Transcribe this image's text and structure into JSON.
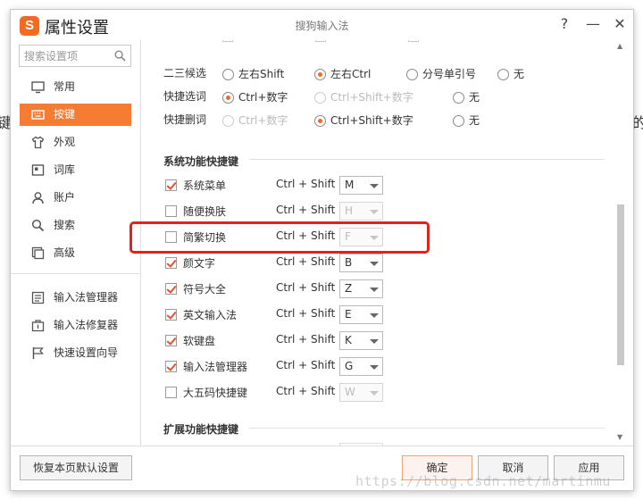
{
  "background": {
    "left_char": "键",
    "right_char": "的"
  },
  "window": {
    "title": "属性设置",
    "app_name": "搜狗输入法",
    "logo_char": "S",
    "help_label": "?",
    "minimize_label": "—",
    "close_label": "✕"
  },
  "sidebar": {
    "search_placeholder": "搜索设置项",
    "items": [
      {
        "label": "常用",
        "icon": "monitor-icon"
      },
      {
        "label": "按键",
        "icon": "keyboard-icon",
        "active": true
      },
      {
        "label": "外观",
        "icon": "shirt-icon"
      },
      {
        "label": "词库",
        "icon": "book-icon"
      },
      {
        "label": "账户",
        "icon": "user-icon"
      },
      {
        "label": "搜索",
        "icon": "search-icon"
      },
      {
        "label": "高级",
        "icon": "advanced-icon"
      }
    ],
    "tools": [
      {
        "label": "输入法管理器",
        "icon": "manager-icon"
      },
      {
        "label": "输入法修复器",
        "icon": "repair-icon"
      },
      {
        "label": "快速设置向导",
        "icon": "flag-icon"
      }
    ]
  },
  "candidates": {
    "second_third": {
      "label": "二三候选",
      "options": [
        "左右Shift",
        "左右Ctrl",
        "分号单引号",
        "无"
      ],
      "selected": "左右Ctrl"
    },
    "quick_select": {
      "label": "快捷选词",
      "options": [
        "Ctrl+数字",
        "Ctrl+Shift+数字",
        "无"
      ],
      "selected": "Ctrl+数字"
    },
    "quick_delete": {
      "label": "快捷删词",
      "options": [
        "Ctrl+数字",
        "Ctrl+Shift+数字",
        "无"
      ],
      "selected": "Ctrl+Shift+数字"
    }
  },
  "system_hotkeys": {
    "title": "系统功能快捷键",
    "combo_prefix": "Ctrl + Shift +",
    "items": [
      {
        "label": "系统菜单",
        "checked": true,
        "key": "M"
      },
      {
        "label": "随便换肤",
        "checked": false,
        "key": "H"
      },
      {
        "label": "简繁切换",
        "checked": false,
        "key": "F"
      },
      {
        "label": "颜文字",
        "checked": true,
        "key": "B"
      },
      {
        "label": "符号大全",
        "checked": true,
        "key": "Z"
      },
      {
        "label": "英文输入法",
        "checked": true,
        "key": "E"
      },
      {
        "label": "软键盘",
        "checked": true,
        "key": "K"
      },
      {
        "label": "输入法管理器",
        "checked": true,
        "key": "G"
      },
      {
        "label": "大五码快捷键",
        "checked": false,
        "key": "W"
      }
    ]
  },
  "extended_hotkeys": {
    "title": "扩展功能快捷键"
  },
  "footer": {
    "restore_label": "恢复本页默认设置",
    "ok_label": "确定",
    "cancel_label": "取消",
    "apply_label": "应用"
  },
  "watermark": "https://blog.csdn.net/martinmu",
  "colors": {
    "accent": "#f57c32",
    "highlight": "#e52020",
    "checkmark": "#e0532e"
  }
}
